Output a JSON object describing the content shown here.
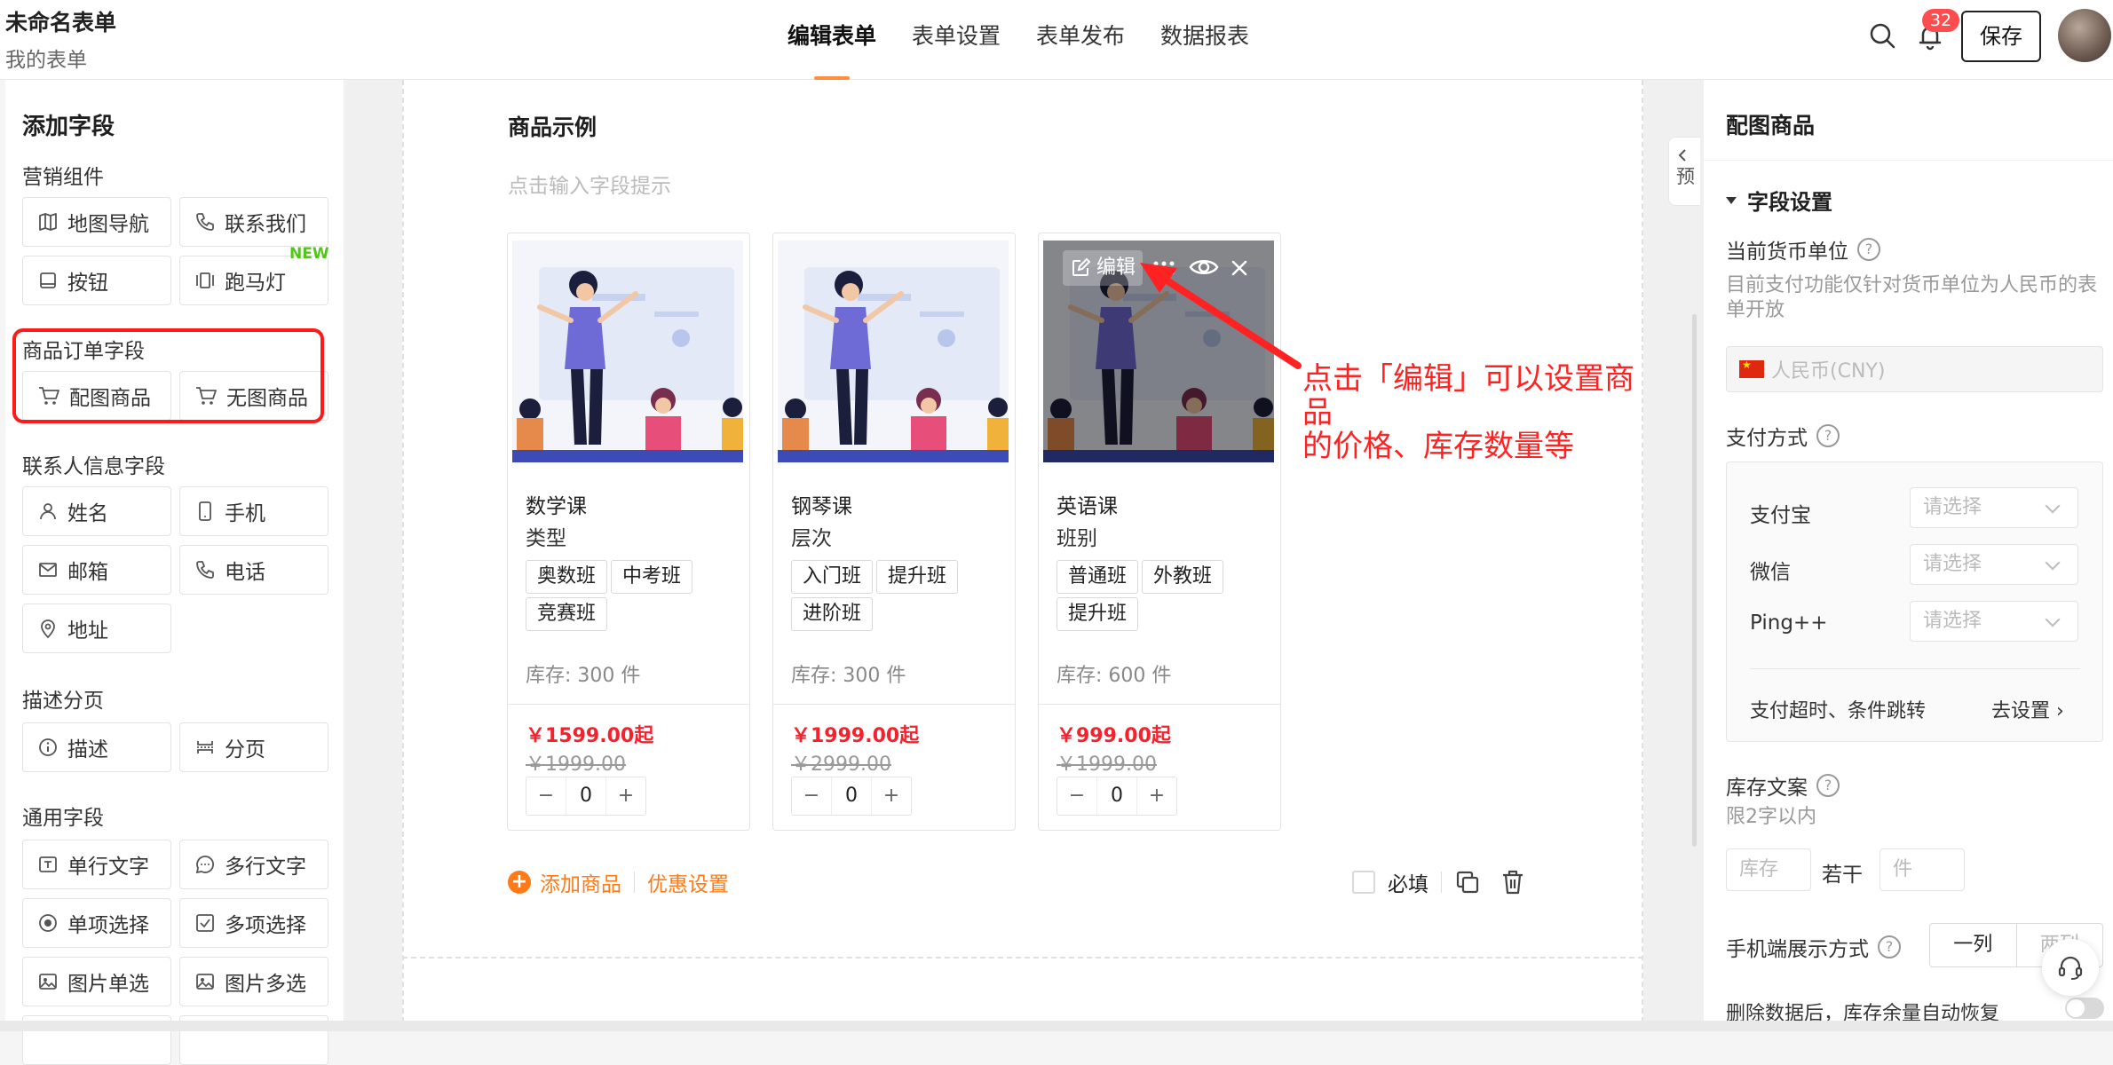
{
  "header": {
    "form_title": "未命名表单",
    "breadcrumb": "我的表单",
    "tabs": [
      "编辑表单",
      "表单设置",
      "表单发布",
      "数据报表"
    ],
    "active_tab": "编辑表单",
    "notification_count": "32",
    "save_label": "保存",
    "accent_color": "#ff8f3f"
  },
  "left": {
    "title": "添加字段",
    "groups": {
      "marketing": "营销组件",
      "order": "商品订单字段",
      "contact": "联系人信息字段",
      "desc": "描述分页",
      "common": "通用字段"
    },
    "marketing_items": [
      "地图导航",
      "联系我们",
      "按钮",
      "跑马灯"
    ],
    "new_tag": "NEW",
    "order_items": [
      "配图商品",
      "无图商品"
    ],
    "contact_items": [
      "姓名",
      "手机",
      "邮箱",
      "电话",
      "地址"
    ],
    "desc_items": [
      "描述",
      "分页"
    ],
    "common_items": [
      "单行文字",
      "多行文字",
      "单项选择",
      "多项选择",
      "图片单选",
      "图片多选"
    ]
  },
  "canvas": {
    "section_title": "商品示例",
    "section_hint": "点击输入字段提示",
    "preview_label": "预",
    "products": [
      {
        "name": "数学课",
        "spec": "类型",
        "tags": [
          "奥数班",
          "中考班",
          "竞赛班"
        ],
        "stock": "库存: 300 件",
        "price": "￥1599.00起",
        "orig": "￥1999.00",
        "qty": "0"
      },
      {
        "name": "钢琴课",
        "spec": "层次",
        "tags": [
          "入门班",
          "提升班",
          "进阶班"
        ],
        "stock": "库存: 300 件",
        "price": "￥1999.00起",
        "orig": "￥2999.00",
        "qty": "0"
      },
      {
        "name": "英语课",
        "spec": "班别",
        "tags": [
          "普通班",
          "外教班",
          "提升班"
        ],
        "stock": "库存: 600 件",
        "price": "￥999.00起",
        "orig": "￥1999.00",
        "qty": "0"
      }
    ],
    "edit_label": "编辑",
    "annotation_line1": "点击「编辑」可以设置商品",
    "annotation_line2": "的价格、库存数量等",
    "add_product": "添加商品",
    "coupon": "优惠设置",
    "required": "必填",
    "stepper_minus": "−",
    "stepper_plus": "+"
  },
  "right": {
    "title": "配图商品",
    "section": "字段设置",
    "currency_label": "当前货币单位",
    "currency_help": "目前支付功能仅针对货币单位为人民币的表单开放",
    "currency_value": "人民币(CNY)",
    "payment_label": "支付方式",
    "payments": [
      "支付宝",
      "微信",
      "Ping++"
    ],
    "select_placeholder": "请选择",
    "pay_timeout": "支付超时、条件跳转",
    "go_set": "去设置 ›",
    "stock_label": "库存文案",
    "stock_hint": "限2字以内",
    "stock_ph1": "库存",
    "stock_mid": "若干",
    "stock_ph2": "件",
    "mobile_display": "手机端展示方式",
    "display_opts": [
      "一列",
      "两列"
    ],
    "auto_restore": "删除数据后，库存余量自动恢复"
  }
}
